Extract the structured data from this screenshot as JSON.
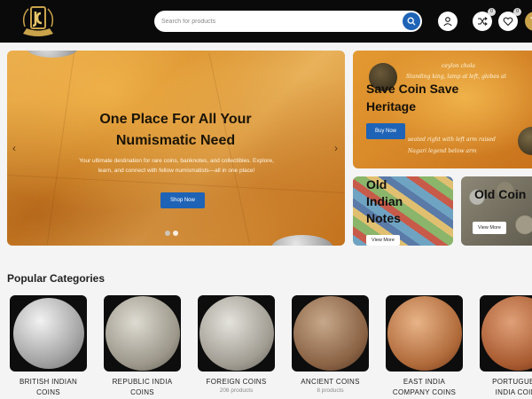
{
  "header": {
    "search_placeholder": "Search for products",
    "compare_count": "0",
    "wishlist_count": "0"
  },
  "hero": {
    "title_line1": "One Place For All Your",
    "title_line2": "Numismatic Need",
    "description": "Your ultimate destination for rare coins, banknotes, and collectibles. Explore, learn, and connect with fellow numismatists—all in one place!",
    "button": "Shop Now",
    "prev_arrow": "‹",
    "next_arrow": "›"
  },
  "banners": [
    {
      "title_line1": "Save Coin Save",
      "title_line2": "Heritage",
      "button": "Buy Now",
      "script_top_line1": "ceylon chola",
      "script_top_line2": "Standing king, lamp at left, globes at",
      "script_bottom_line1": "seated right with left arm raised",
      "script_bottom_line2": "Nagari legend below arm"
    },
    {
      "title_line1": "Old",
      "title_line2": "Indian",
      "title_line3": "Notes",
      "button": "View More"
    },
    {
      "title": "Old Coin",
      "button": "View More"
    }
  ],
  "categories": {
    "heading": "Popular Categories",
    "items": [
      {
        "name_line1": "BRITISH INDIAN",
        "name_line2": "COINS",
        "count": ""
      },
      {
        "name_line1": "REPUBLIC INDIA",
        "name_line2": "COINS",
        "count": ""
      },
      {
        "name_line1": "FOREIGN COINS",
        "name_line2": "",
        "count": "206 products"
      },
      {
        "name_line1": "ANCIENT COINS",
        "name_line2": "",
        "count": "8 products"
      },
      {
        "name_line1": "EAST INDIA",
        "name_line2": "COMPANY COINS",
        "count": ""
      },
      {
        "name_line1": "PORTUGUESE",
        "name_line2": "INDIA COINS",
        "count": ""
      }
    ]
  },
  "colors": {
    "header_bg": "#0a0a0a",
    "accent_blue": "#1e63b6",
    "gold": "#c9a24a"
  }
}
